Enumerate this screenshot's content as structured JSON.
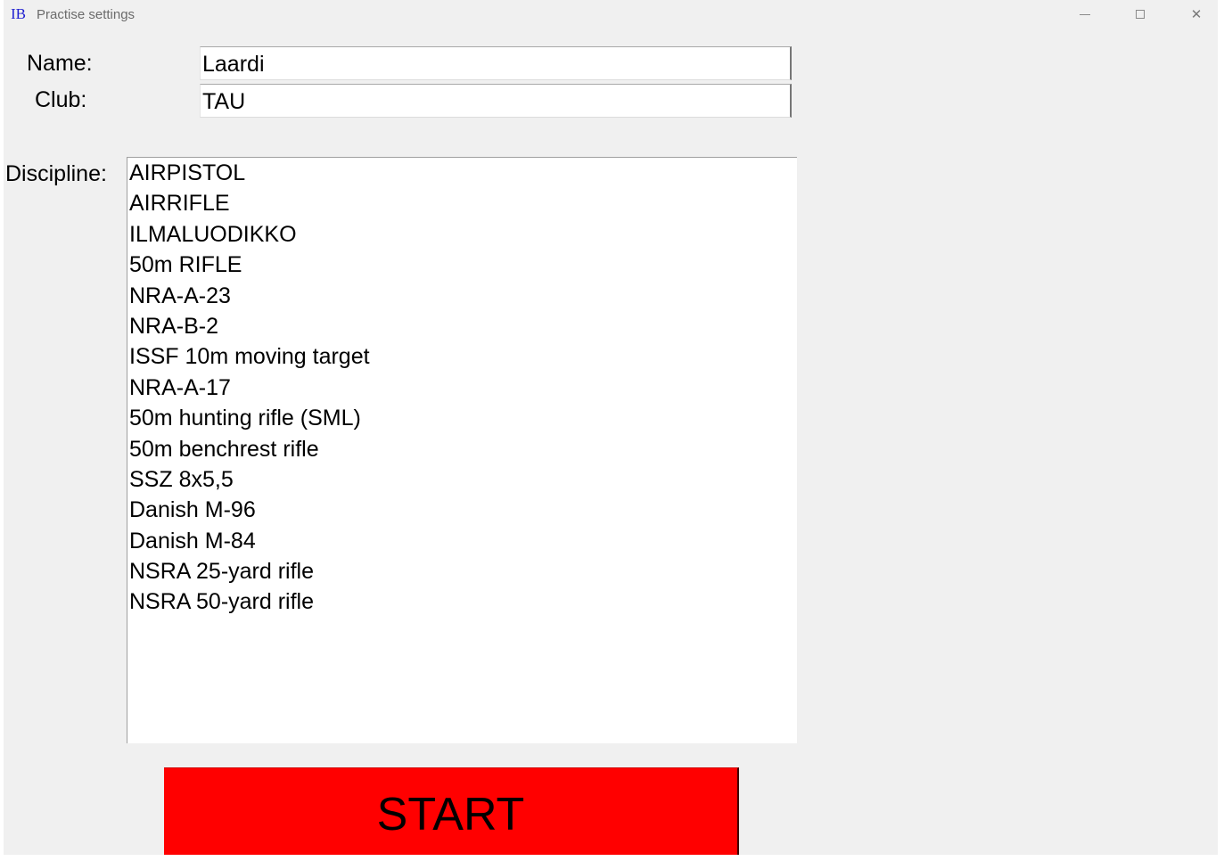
{
  "window": {
    "app_icon_text": "IB",
    "title": "Practise settings",
    "controls": {
      "minimize_icon": "minimize-icon",
      "maximize_icon": "maximize-icon",
      "close_icon": "close-icon",
      "close_glyph": "✕"
    }
  },
  "form": {
    "name_label": "Name:",
    "name_value": "Laardi",
    "club_label": "Club:",
    "club_value": "TAU",
    "discipline_label": "Discipline:",
    "disciplines": [
      "AIRPISTOL",
      "AIRRIFLE",
      "ILMALUODIKKO",
      "50m RIFLE",
      "NRA-A-23",
      "NRA-B-2",
      "ISSF 10m moving target",
      "NRA-A-17",
      "50m hunting rifle (SML)",
      "50m benchrest rifle",
      "SSZ 8x5,5",
      "Danish M-96",
      "Danish M-84",
      "NSRA 25-yard rifle",
      "NSRA 50-yard rifle"
    ]
  },
  "start_button": {
    "label": "START",
    "color": "#ff0000"
  }
}
